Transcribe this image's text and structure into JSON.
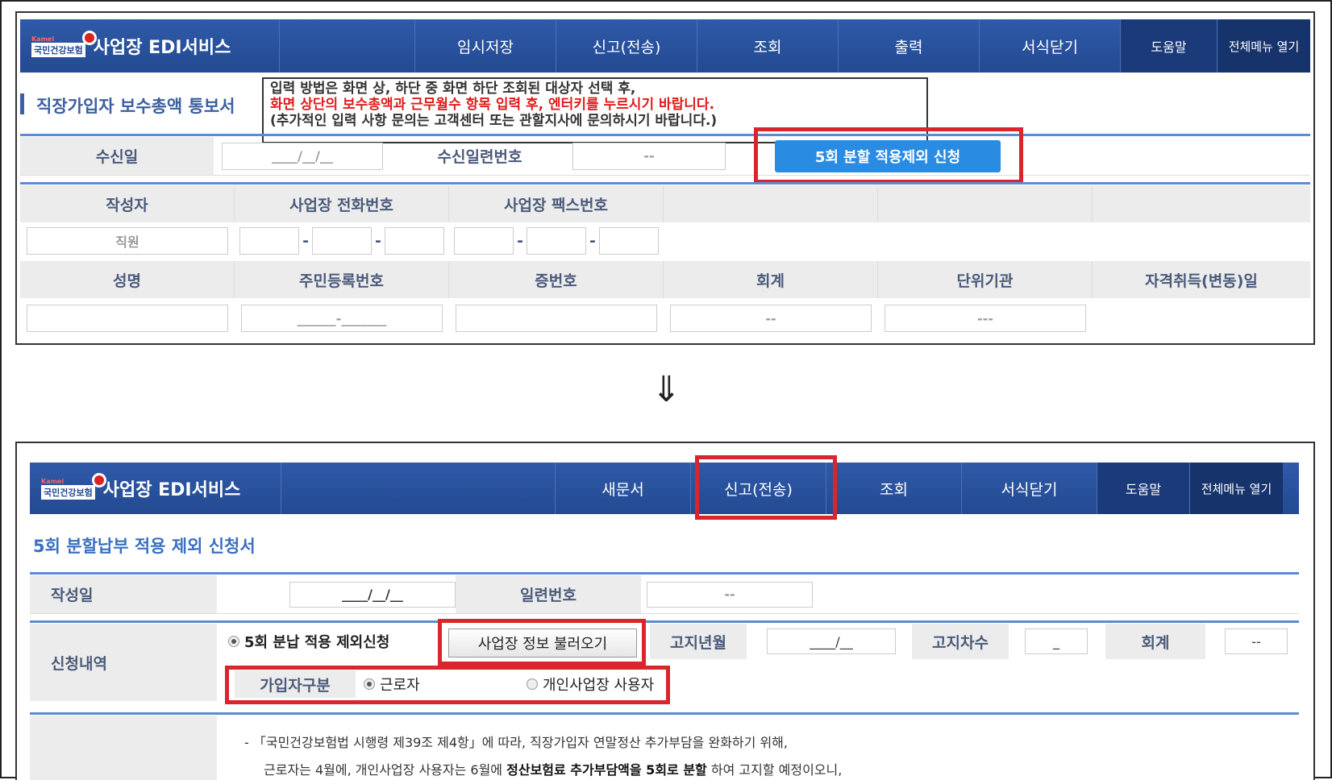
{
  "arrow": "⇓",
  "top_panel": {
    "brand_small": "Kamei",
    "brand_logo": "국민건강보험",
    "brand_title": "사업장 EDI서비스",
    "nav": [
      "임시저장",
      "신고(전송)",
      "조회",
      "출력",
      "서식닫기"
    ],
    "nav_help": "도움말",
    "nav_all": "전체메뉴 열기",
    "page_title": "직장가입자 보수총액 통보서",
    "notice_line1": "입력 방법은 화면 상, 하단 중 화면 하단 조회된 대상자 선택 후,",
    "notice_line2": "화면 상단의 보수총액과 근무월수 항목 입력 후, 엔터키를 누르시기 바랍니다.",
    "notice_line3": "(추가적인 입력 사항 문의는 고객센터 또는 관할지사에 문의하시기 바랍니다.)",
    "recv_date_label": "수신일",
    "recv_date_value": "____/__/__",
    "recv_serial_label": "수신일련번호",
    "recv_serial_value": "--",
    "exclusion_button": "5회 분할 적용제외 신청",
    "writer_label": "작성자",
    "phone_label": "사업장 전화번호",
    "fax_label": "사업장 팩스번호",
    "writer_value": "직원",
    "dash": "-",
    "headers2": [
      "성명",
      "주민등록번호",
      "증번호",
      "회계",
      "단위기관",
      "자격취득(변동)일"
    ],
    "values2": [
      "",
      "______-_______",
      "",
      "--",
      "---",
      ""
    ]
  },
  "bottom_panel": {
    "brand_small": "Kamei",
    "brand_logo": "국민건강보험",
    "brand_title": "사업장 EDI서비스",
    "nav": [
      "새문서",
      "신고(전송)",
      "조회",
      "서식닫기"
    ],
    "nav_help": "도움말",
    "nav_all": "전체메뉴 열기",
    "page_title": "5회 분할납부 적용 제외 신청서",
    "write_date_label": "작성일",
    "write_date_value": "____/__/__",
    "serial_label": "일련번호",
    "serial_value": "--",
    "apply_label": "신청내역",
    "apply_radio": "5회 분납 적용 제외신청",
    "load_button": "사업장 정보 불러오기",
    "notice_ym_label": "고지년월",
    "notice_ym_value": "____/__",
    "notice_count_label": "고지차수",
    "notice_count_value": "_",
    "account_label": "회계",
    "account_value": "--",
    "member_type_label": "가입자구분",
    "member_worker": "근로자",
    "member_self": "개인사업장 사용자",
    "para1": "- 「국민건강보험법 시행령 제39조 제4항」에 따라, 직장가입자 연말정산 추가부담을 완화하기 위해,",
    "para2_a": "근로자는 4월에, 개인사업장 사용자는 6월에 ",
    "para2_b": "정산보험료 추가부담액을 5회로 분할",
    "para2_c": " 하여 고지할 예정이오니,"
  }
}
